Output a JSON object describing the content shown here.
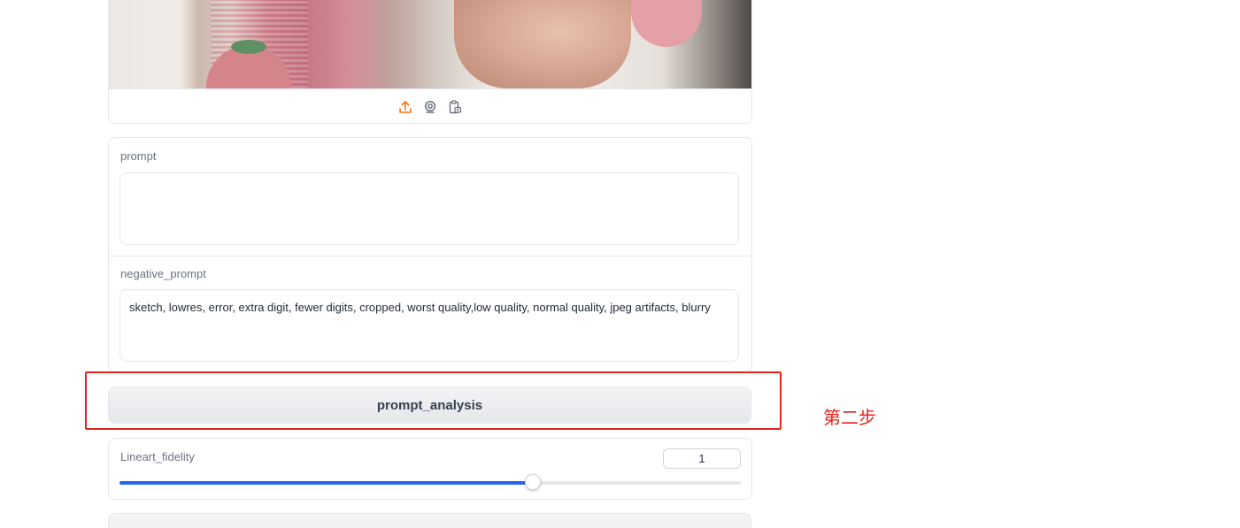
{
  "image_input": {
    "sources": [
      {
        "name": "upload",
        "icon": "upload-icon",
        "color": "#f97316"
      },
      {
        "name": "webcam",
        "icon": "webcam-icon",
        "color": "#6b7280"
      },
      {
        "name": "clipboard",
        "icon": "clipboard-icon",
        "color": "#6b7280"
      }
    ]
  },
  "prompt": {
    "label": "prompt",
    "value": ""
  },
  "negative_prompt": {
    "label": "negative_prompt",
    "value": "sketch, lowres, error, extra digit, fewer digits, cropped, worst quality,low quality, normal quality, jpeg artifacts, blurry"
  },
  "prompt_analysis": {
    "label": "prompt_analysis"
  },
  "annotation": {
    "text": "第二步",
    "color": "#e8231d"
  },
  "lineart_fidelity": {
    "label": "Lineart_fidelity",
    "value": "1",
    "slider_fraction": 0.665,
    "accent": "#2563eb"
  }
}
